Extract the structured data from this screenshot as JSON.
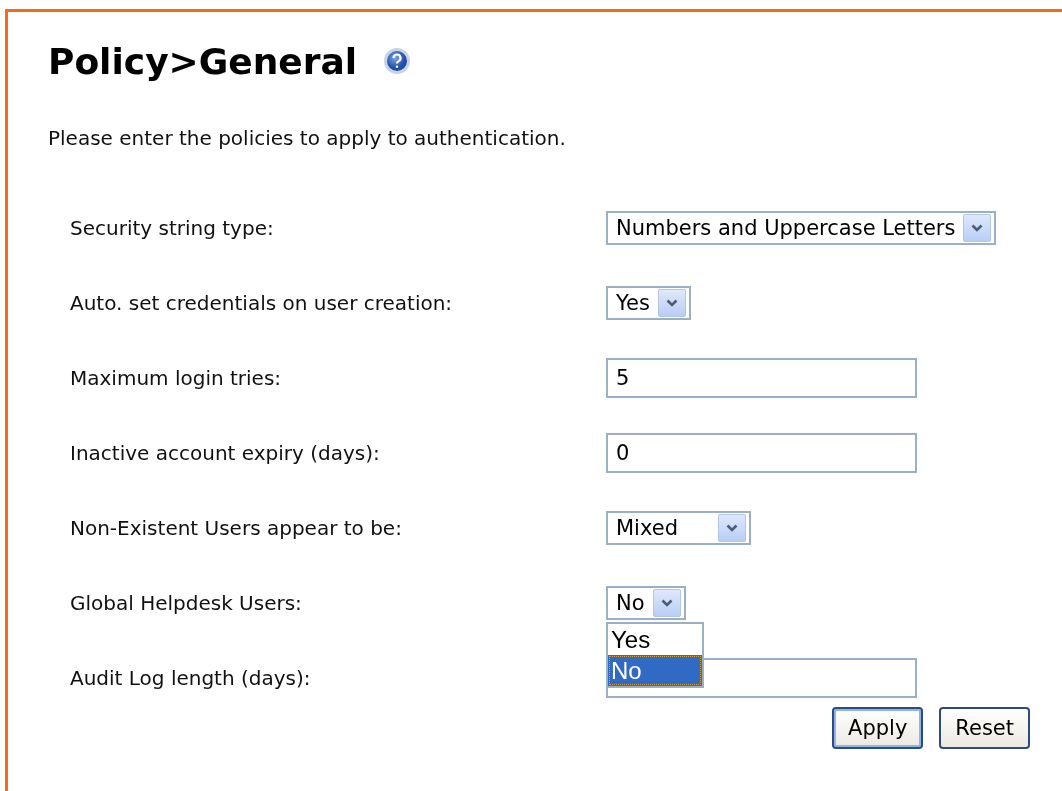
{
  "heading": {
    "title": "Policy>General"
  },
  "description": "Please enter the policies to apply to authentication.",
  "fields": [
    {
      "kind": "select",
      "label": "Security string type:",
      "value": "Numbers and Uppercase Letters"
    },
    {
      "kind": "select",
      "label": "Auto. set credentials on user creation:",
      "value": "Yes"
    },
    {
      "kind": "text",
      "label": "Maximum login tries:",
      "value": "5"
    },
    {
      "kind": "text",
      "label": "Inactive account expiry (days):",
      "value": "0"
    },
    {
      "kind": "select",
      "label": "Non-Existent Users appear to be:",
      "value": "Mixed"
    },
    {
      "kind": "select",
      "label": "Global Helpdesk Users:",
      "value": "No",
      "expanded": true,
      "options": [
        {
          "label": "Yes",
          "selected": false
        },
        {
          "label": "No",
          "selected": true
        }
      ]
    },
    {
      "kind": "text",
      "label": "Audit Log length (days):"
    }
  ],
  "buttons": [
    {
      "label": "Apply",
      "default": true
    },
    {
      "label": "Reset",
      "default": false
    }
  ]
}
